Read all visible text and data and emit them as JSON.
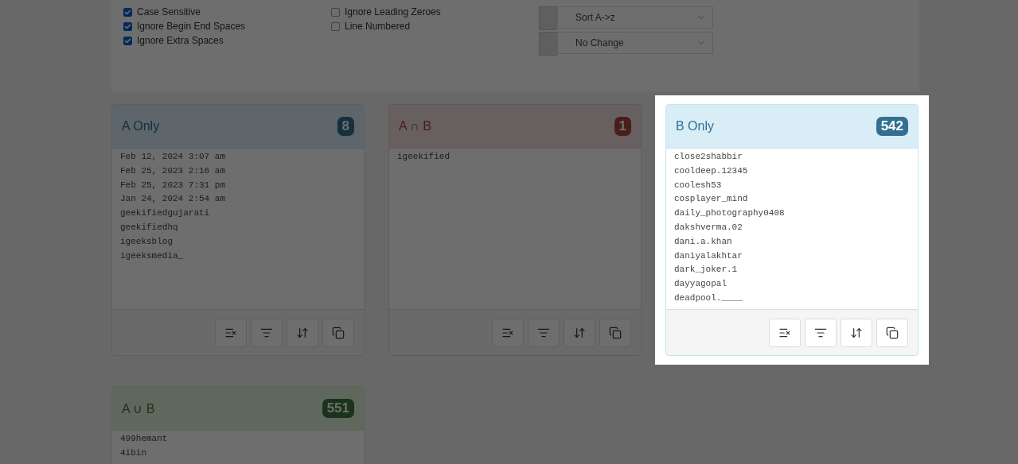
{
  "options": {
    "checkboxes": [
      {
        "label": "Case Sensitive",
        "checked": true
      },
      {
        "label": "Ignore Begin End Spaces",
        "checked": true
      },
      {
        "label": "Ignore Extra Spaces",
        "checked": true
      },
      {
        "label": "Ignore Leading Zeroes",
        "checked": false
      },
      {
        "label": "Line Numbered",
        "checked": false
      }
    ],
    "selects": [
      {
        "value": "Sort A->z"
      },
      {
        "value": "No Change"
      }
    ]
  },
  "cards": [
    {
      "kind": "info",
      "title": "A Only",
      "count": "8",
      "highlighted": false,
      "lines": [
        "Feb 12, 2024 3:07 am",
        "Feb 25, 2023 2:16 am",
        "Feb 25, 2023 7:31 pm",
        "Jan 24, 2024 2:54 am",
        "geekifiedgujarati",
        "geekifiedhq",
        "igeeksblog",
        "igeeksmedia_"
      ]
    },
    {
      "kind": "danger",
      "title": "A ∩ B",
      "count": "1",
      "highlighted": false,
      "lines": [
        "igeekified"
      ]
    },
    {
      "kind": "info",
      "title": "B Only",
      "count": "542",
      "highlighted": true,
      "lines": [
        "close2shabbir",
        "cooldeep.12345",
        "coolesh53",
        "cosplayer_mind",
        "daily_photography0408",
        "dakshverma.02",
        "dani.a.khan",
        "daniyalakhtar",
        "dark_joker.1",
        "dayyagopal",
        "deadpool.____"
      ]
    },
    {
      "kind": "success",
      "title": "A ∪ B",
      "count": "551",
      "highlighted": false,
      "lines": [
        "499hemant",
        "4ibin"
      ]
    }
  ]
}
